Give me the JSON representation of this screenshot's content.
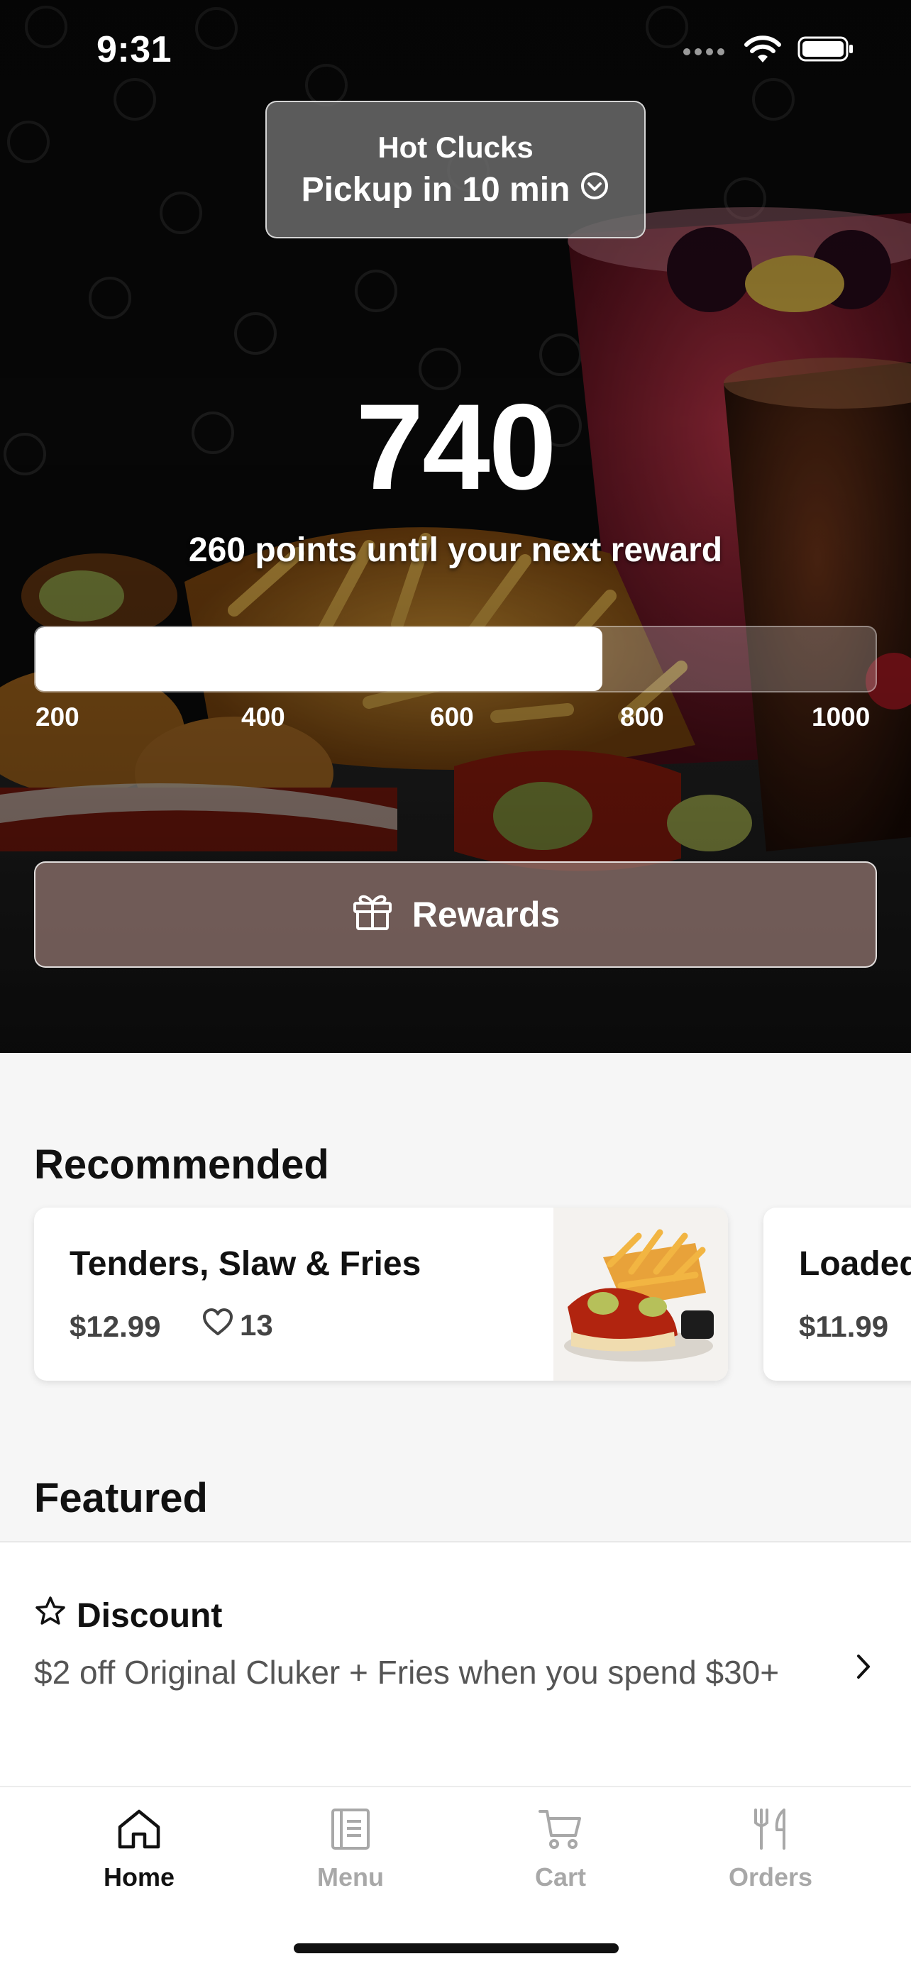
{
  "status_bar": {
    "time": "9:31"
  },
  "location": {
    "name": "Hot Clucks",
    "pickup": "Pickup in 10 min"
  },
  "points": {
    "value": "740",
    "caption": "260 points until your next reward",
    "progress": {
      "current": 740,
      "min": 200,
      "max": 1000
    },
    "ticks": [
      "200",
      "400",
      "600",
      "800",
      "1000"
    ]
  },
  "rewards_button": {
    "label": "Rewards"
  },
  "recommended": {
    "title": "Recommended",
    "items": [
      {
        "name": "Tenders, Slaw & Fries",
        "price": "$12.99",
        "likes": "13"
      },
      {
        "name": "Loaded",
        "price": "$11.99"
      }
    ]
  },
  "featured": {
    "title": "Featured",
    "item": {
      "title": "Discount",
      "description": "$2 off Original Cluker + Fries when you spend $30+"
    }
  },
  "tabs": [
    {
      "label": "Home",
      "icon": "home-icon",
      "active": true
    },
    {
      "label": "Menu",
      "icon": "menu-icon",
      "active": false
    },
    {
      "label": "Cart",
      "icon": "cart-icon",
      "active": false
    },
    {
      "label": "Orders",
      "icon": "orders-icon",
      "active": false
    }
  ],
  "colors": {
    "accent": "#111111",
    "inactive": "#a8a8a8",
    "background": "#f6f6f6"
  }
}
